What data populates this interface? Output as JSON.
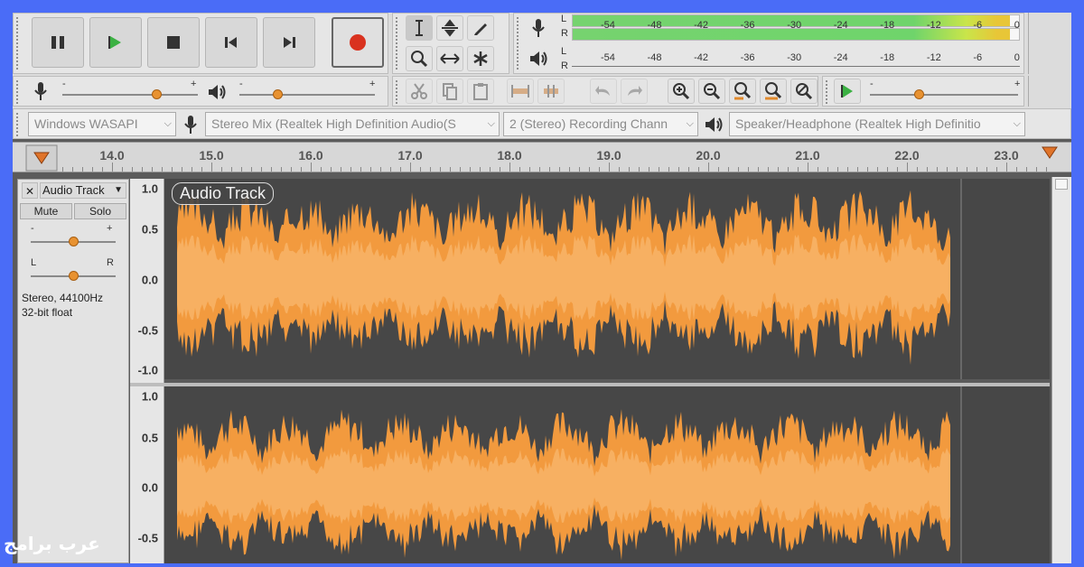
{
  "transport": {
    "pause_icon": "pause-icon",
    "play_icon": "play-icon",
    "stop_icon": "stop-icon",
    "skip_start_icon": "skip-to-start-icon",
    "skip_end_icon": "skip-to-end-icon",
    "record_icon": "record-icon"
  },
  "meters": {
    "record_scale": [
      "-54",
      "-48",
      "-42",
      "-36",
      "-30",
      "-24",
      "-18",
      "-12",
      "-6",
      "0"
    ],
    "playback_scale": [
      "-54",
      "-48",
      "-42",
      "-36",
      "-30",
      "-24",
      "-18",
      "-12",
      "-6",
      "0"
    ],
    "channel_left": "L",
    "channel_right": "R",
    "record_level_fraction": 0.98
  },
  "mixer": {
    "minus": "-",
    "plus": "+",
    "record_volume": 0.69,
    "playback_volume": 0.28,
    "play_speed": 0.33
  },
  "devices": {
    "host": "Windows WASAPI",
    "recording_device": "Stereo Mix (Realtek High Definition Audio(S",
    "channels": "2 (Stereo) Recording Chann",
    "playback_device": "Speaker/Headphone (Realtek High Definitio"
  },
  "timeline": {
    "ticks": [
      "14.0",
      "15.0",
      "16.0",
      "17.0",
      "18.0",
      "19.0",
      "20.0",
      "21.0",
      "22.0",
      "23.0"
    ]
  },
  "track": {
    "close": "✕",
    "name": "Audio Track",
    "mute": "Mute",
    "solo": "Solo",
    "gain_minus": "-",
    "gain_plus": "+",
    "pan_left": "L",
    "pan_right": "R",
    "gain": 0.5,
    "pan": 0.5,
    "format_line1": "Stereo, 44100Hz",
    "format_line2": "32-bit float",
    "clip_name": "Audio Track"
  },
  "ruler": {
    "labels": [
      "1.0",
      "0.5",
      "0.0",
      "-0.5",
      "-1.0"
    ]
  },
  "colors": {
    "waveform": "#f29a3e",
    "waveform_rms": "#f7b062",
    "background": "#474747"
  },
  "watermark": "عرب برامج"
}
